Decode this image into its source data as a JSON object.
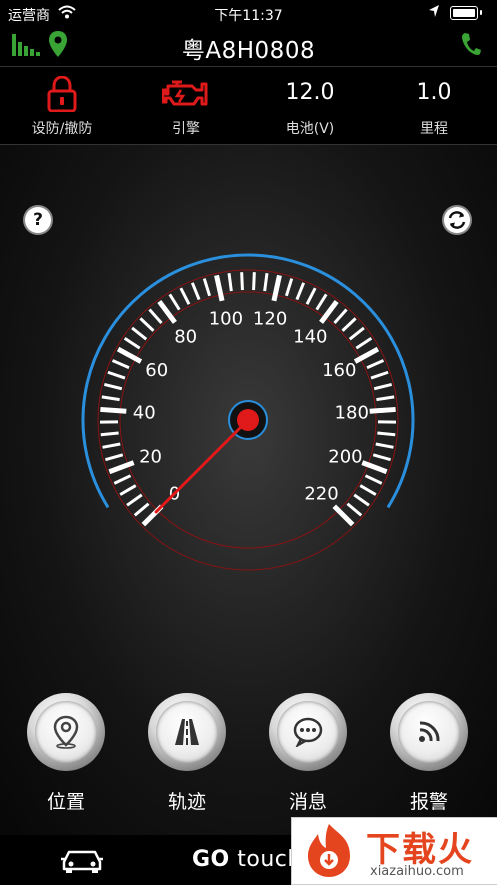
{
  "status_bar": {
    "carrier": "运营商",
    "time": "下午11:37"
  },
  "nav": {
    "title": "粤A8H0808"
  },
  "stats": [
    {
      "label": "设防/撤防",
      "icon": "lock-icon"
    },
    {
      "label": "引擎",
      "icon": "engine-icon"
    },
    {
      "value": "12.0",
      "label": "电池(V)"
    },
    {
      "value": "1.0",
      "label": "里程"
    }
  ],
  "gauge": {
    "help_symbol": "?",
    "ticks": [
      "0",
      "20",
      "40",
      "60",
      "80",
      "100",
      "120",
      "140",
      "160",
      "180",
      "200",
      "220"
    ],
    "speed": 0
  },
  "actions": [
    {
      "label": "位置",
      "icon": "location-pin-icon"
    },
    {
      "label": "轨迹",
      "icon": "road-icon"
    },
    {
      "label": "消息",
      "icon": "message-bubble-icon"
    },
    {
      "label": "报警",
      "icon": "alarm-signal-icon"
    }
  ],
  "footer": {
    "brand_bold": "GO",
    "brand_rest": " touch"
  },
  "watermark": {
    "text": "下载火",
    "url": "xiazaihuo.com"
  },
  "colors": {
    "accent_red": "#e01a1a",
    "gauge_blue": "#2a8fdc",
    "nav_green": "#3aa335"
  }
}
